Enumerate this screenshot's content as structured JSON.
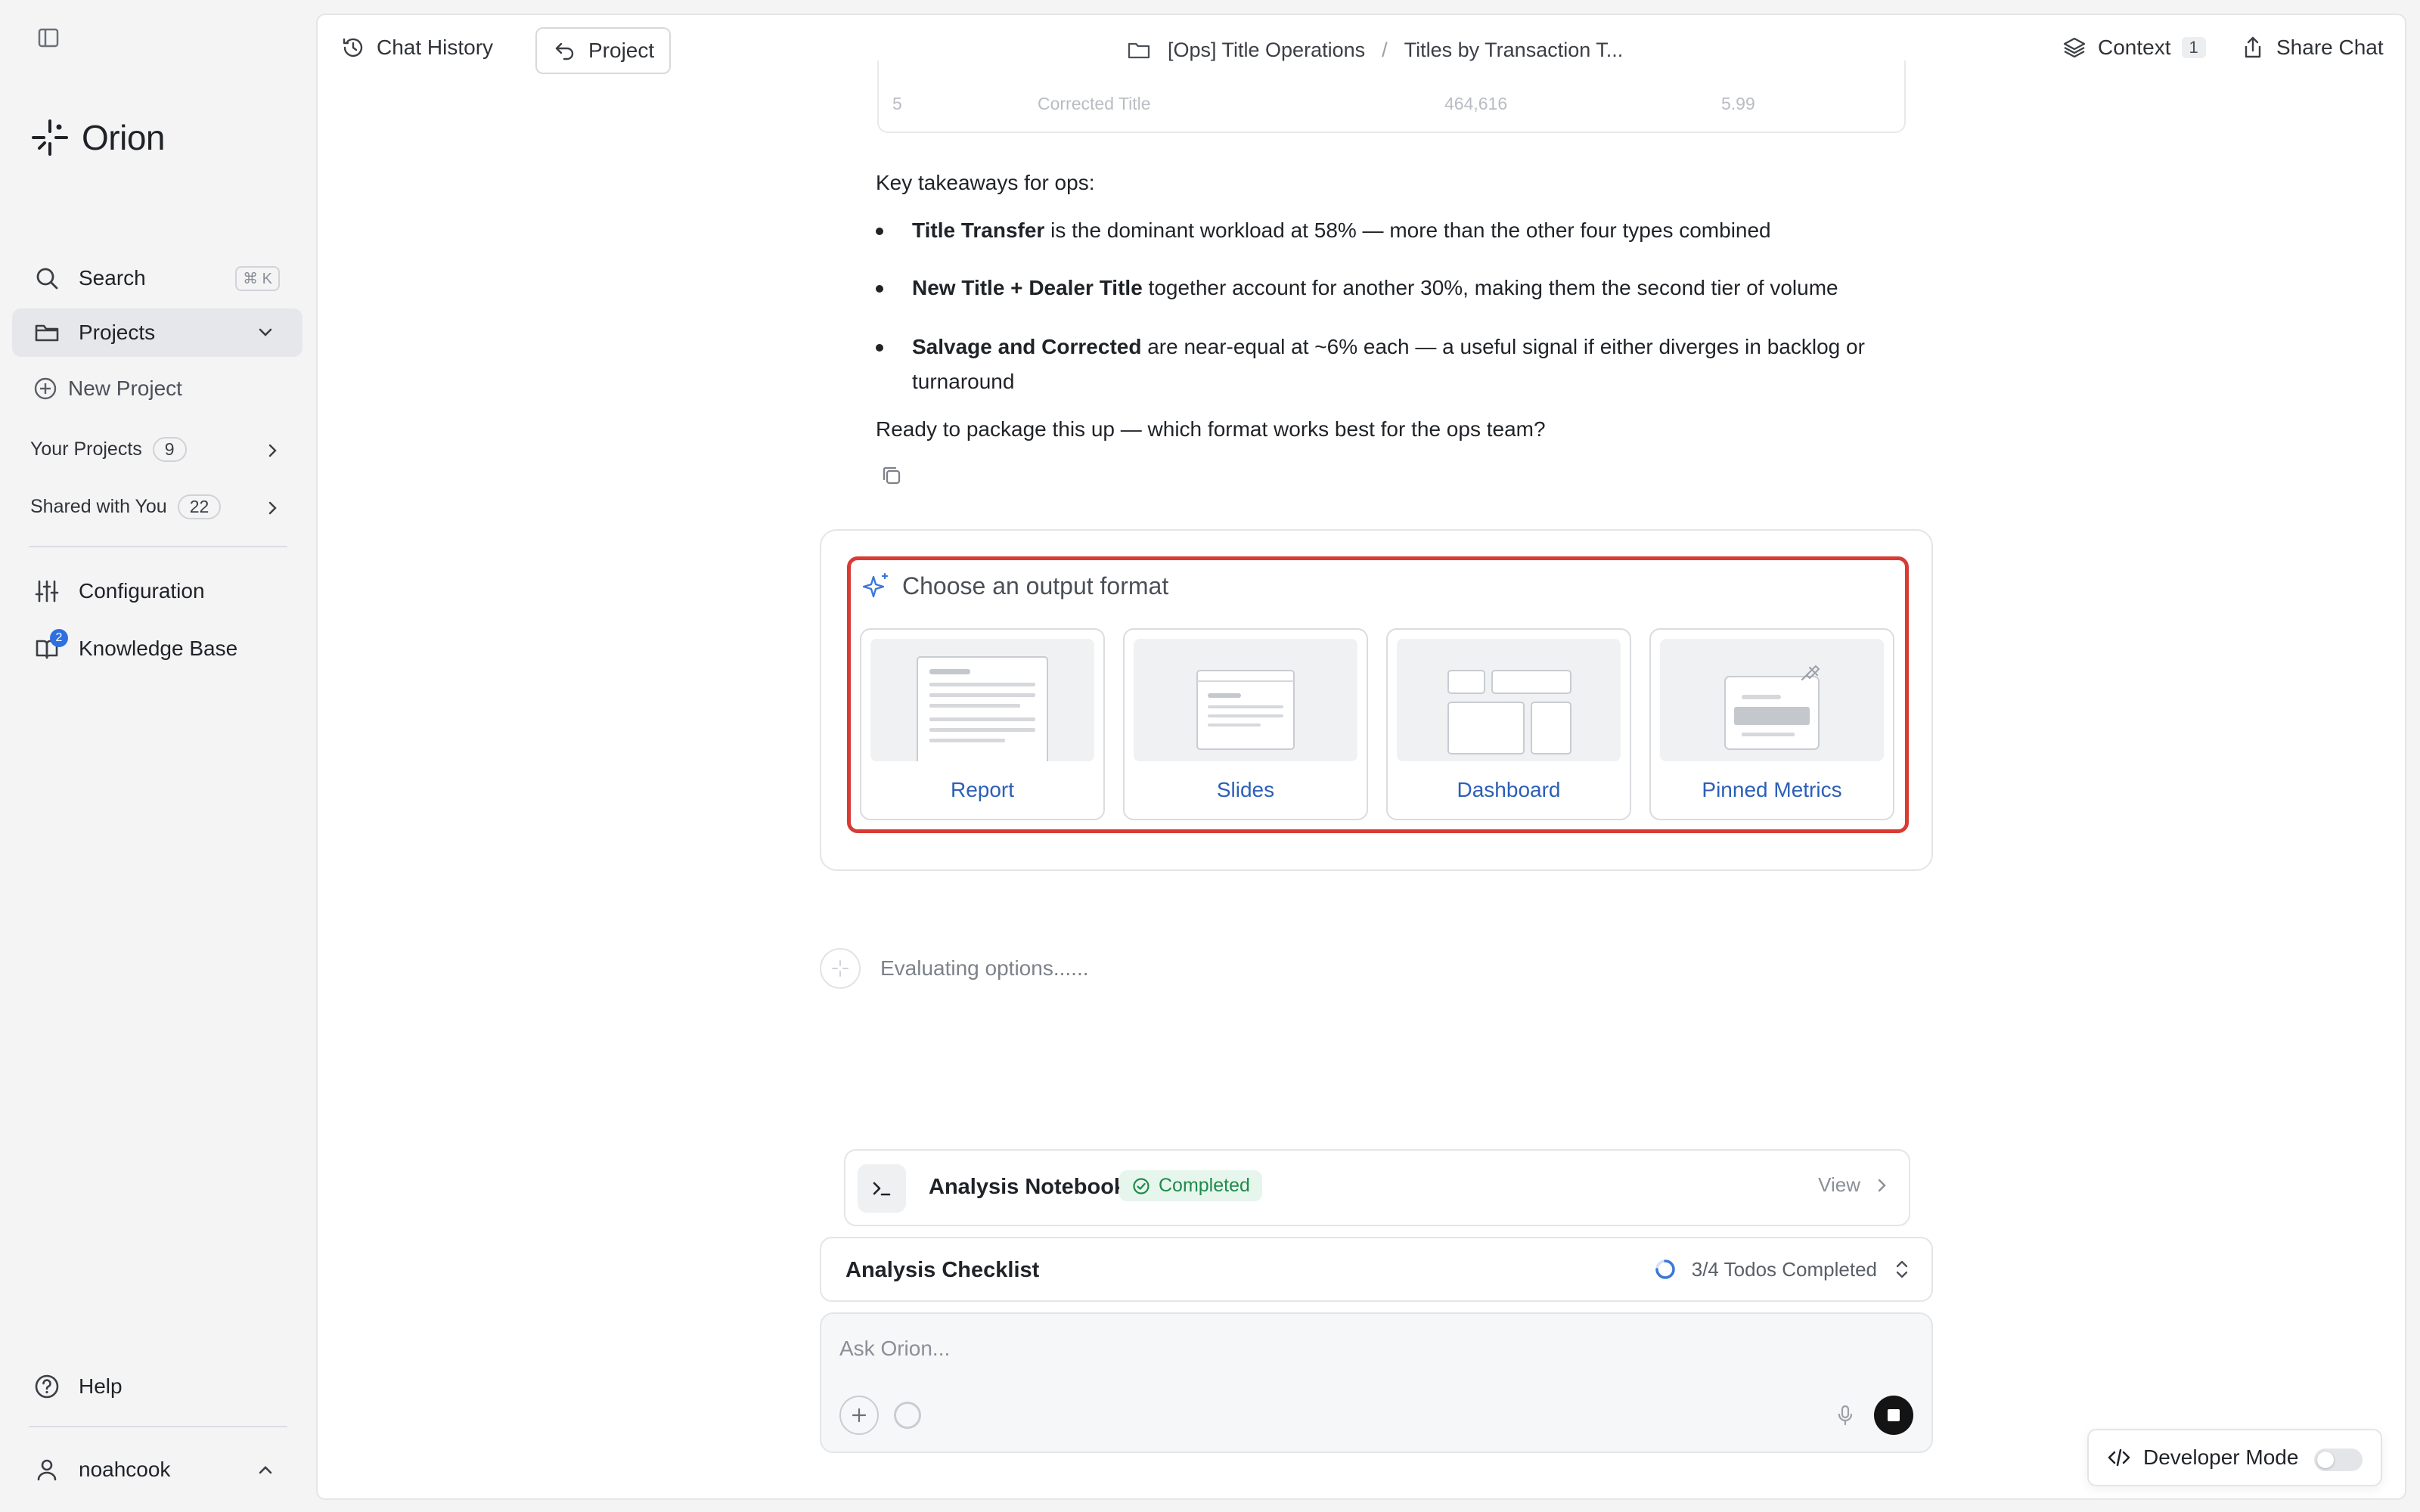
{
  "app": {
    "name": "Orion"
  },
  "sidebar": {
    "search_label": "Search",
    "search_shortcut": "⌘ K",
    "projects_label": "Projects",
    "new_project_label": "New Project",
    "your_projects_label": "Your Projects",
    "your_projects_count": "9",
    "shared_label": "Shared with You",
    "shared_count": "22",
    "configuration_label": "Configuration",
    "knowledge_base_label": "Knowledge Base",
    "knowledge_base_badge": "2",
    "help_label": "Help",
    "user_name": "noahcook"
  },
  "topbar": {
    "chat_history_label": "Chat History",
    "project_button_label": "Project",
    "breadcrumb_folder": "[Ops] Title Operations",
    "breadcrumb_separator": "/",
    "breadcrumb_current": "Titles by Transaction T...",
    "context_label": "Context",
    "context_count": "1",
    "share_label": "Share Chat"
  },
  "table_tail": {
    "rank": "5",
    "type": "Corrected Title",
    "count": "464,616",
    "pct": "5.99"
  },
  "message": {
    "intro": "Key takeaways for ops:",
    "bullets": [
      {
        "bold": "Title Transfer",
        "rest": " is the dominant workload at 58% — more than the other four types combined"
      },
      {
        "bold": "New Title + Dealer Title",
        "rest": " together account for another 30%, making them the second tier of volume"
      },
      {
        "bold": "Salvage and Corrected",
        "rest": " are near-equal at ~6% each — a useful signal if either diverges in backlog or turnaround"
      }
    ],
    "closing": "Ready to package this up — which format works best for the ops team?"
  },
  "chooser": {
    "heading": "Choose an output format",
    "options": [
      {
        "label": "Report"
      },
      {
        "label": "Slides"
      },
      {
        "label": "Dashboard"
      },
      {
        "label": "Pinned Metrics"
      }
    ]
  },
  "status": {
    "evaluating": "Evaluating options......"
  },
  "notebook": {
    "title": "Analysis Notebook",
    "status": "Completed",
    "view_label": "View"
  },
  "checklist": {
    "title": "Analysis Checklist",
    "progress": "3/4 Todos Completed"
  },
  "composer": {
    "placeholder": "Ask Orion..."
  },
  "developer_mode": {
    "label": "Developer Mode",
    "enabled": false
  },
  "colors": {
    "accent_blue": "#2b5fb8",
    "highlight_red": "#d93b34",
    "success_green": "#1f8a4c"
  },
  "icons": [
    "sidebar-toggle-icon",
    "orion-logo-icon",
    "search-icon",
    "folder-icon",
    "chevron-down-icon",
    "plus-circle-icon",
    "chevron-right-icon",
    "sliders-icon",
    "book-icon",
    "help-icon",
    "user-icon",
    "chevron-up-icon",
    "history-icon",
    "undo-arrow-icon",
    "layers-icon",
    "share-icon",
    "copy-icon",
    "sparkle-icon",
    "terminal-icon",
    "check-circle-icon",
    "spinner-icon",
    "up-down-chevron-icon",
    "mic-icon",
    "stop-icon",
    "code-icon",
    "pin-icon"
  ]
}
